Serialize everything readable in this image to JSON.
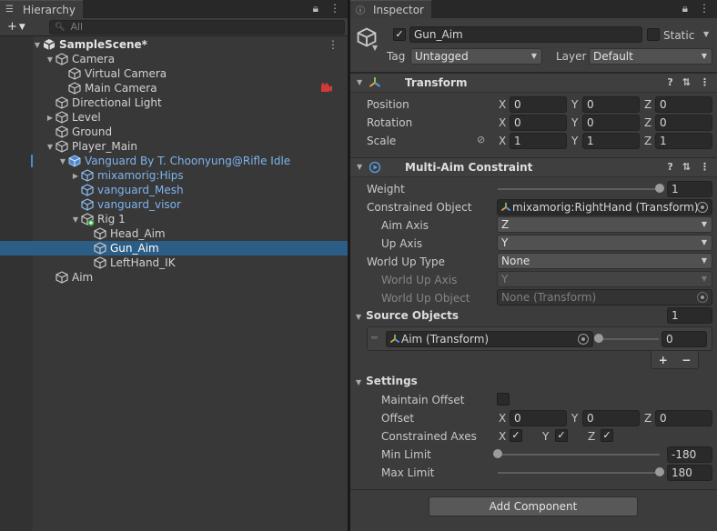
{
  "hierarchy": {
    "tab_label": "Hierarchy",
    "add_label": "+",
    "search_placeholder": "All",
    "scene_name": "SampleScene*",
    "items": [
      {
        "label": "Camera"
      },
      {
        "label": "Virtual Camera"
      },
      {
        "label": "Main Camera"
      },
      {
        "label": "Directional Light"
      },
      {
        "label": "Level"
      },
      {
        "label": "Ground"
      },
      {
        "label": "Player_Main"
      },
      {
        "label": "Vanguard By T. Choonyung@Rifle Idle"
      },
      {
        "label": "mixamorig:Hips"
      },
      {
        "label": "vanguard_Mesh"
      },
      {
        "label": "vanguard_visor"
      },
      {
        "label": "Rig 1"
      },
      {
        "label": "Head_Aim"
      },
      {
        "label": "Gun_Aim"
      },
      {
        "label": "LeftHand_IK"
      },
      {
        "label": "Aim"
      }
    ],
    "selected_item": "Gun_Aim"
  },
  "inspector": {
    "tab_label": "Inspector",
    "object_name": "Gun_Aim",
    "active": true,
    "static_label": "Static",
    "static": false,
    "tag_label": "Tag",
    "tag_value": "Untagged",
    "layer_label": "Layer",
    "layer_value": "Default",
    "transform": {
      "title": "Transform",
      "position_label": "Position",
      "rotation_label": "Rotation",
      "scale_label": "Scale",
      "axis_x": "X",
      "axis_y": "Y",
      "axis_z": "Z",
      "position": [
        "0",
        "0",
        "0"
      ],
      "rotation": [
        "0",
        "0",
        "0"
      ],
      "scale": [
        "1",
        "1",
        "1"
      ]
    },
    "multi_aim": {
      "title": "Multi-Aim Constraint",
      "weight_label": "Weight",
      "weight_value": "1",
      "weight_fraction": 1.0,
      "constrained_object_label": "Constrained Object",
      "constrained_object_value": "mixamorig:RightHand (Transform)",
      "aim_axis_label": "Aim Axis",
      "aim_axis_value": "Z",
      "up_axis_label": "Up Axis",
      "up_axis_value": "Y",
      "world_up_type_label": "World Up Type",
      "world_up_type_value": "None",
      "world_up_axis_label": "World Up Axis",
      "world_up_axis_value": "Y",
      "world_up_object_label": "World Up Object",
      "world_up_object_value": "None (Transform)",
      "source_objects_label": "Source Objects",
      "source_objects_count": "1",
      "source_item_value": "Aim (Transform)",
      "source_item_weight": "0",
      "source_item_weight_fraction": 0.0,
      "add_label": "+",
      "remove_label": "−",
      "settings_label": "Settings",
      "maintain_offset_label": "Maintain Offset",
      "maintain_offset": false,
      "offset_label": "Offset",
      "offset": [
        "0",
        "0",
        "0"
      ],
      "constrained_axes_label": "Constrained Axes",
      "constrained_axes": [
        true,
        true,
        true
      ],
      "min_limit_label": "Min Limit",
      "min_limit_value": "-180",
      "min_limit_fraction": 0.0,
      "max_limit_label": "Max Limit",
      "max_limit_value": "180",
      "max_limit_fraction": 1.0
    },
    "add_component_label": "Add Component"
  },
  "colors": {
    "panel": "#383838",
    "selection": "#2c5d87",
    "prefab_text": "#7eb4ee"
  }
}
